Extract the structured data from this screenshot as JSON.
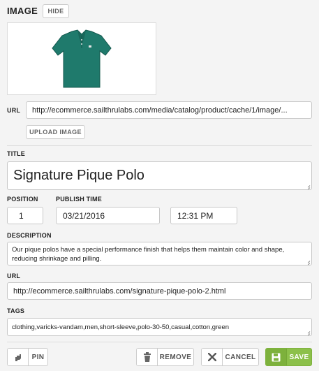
{
  "image_section": {
    "title": "IMAGE",
    "hide_label": "HIDE",
    "url_label": "URL",
    "url_value": "http://ecommerce.sailthrulabs.com/media/catalog/product/cache/1/image/...",
    "upload_label": "UPLOAD IMAGE",
    "thumbnail_color": "#1f7a6c"
  },
  "form": {
    "title_label": "TITLE",
    "title_value": "Signature Pique Polo",
    "position_label": "POSITION",
    "position_value": "1",
    "publish_label": "PUBLISH TIME",
    "publish_date": "03/21/2016",
    "publish_time": "12:31 PM",
    "description_label": "DESCRIPTION",
    "description_value": "Our pique polos have a special performance finish that helps them maintain color and shape, reducing shrinkage and pilling.",
    "url_label": "URL",
    "url_value": "http://ecommerce.sailthrulabs.com/signature-pique-polo-2.html",
    "tags_label": "TAGS",
    "tags_value": "clothing,varicks-vandam,men,short-sleeve,polo-30-50,casual,cotton,green"
  },
  "actions": {
    "pin": "PIN",
    "remove": "REMOVE",
    "cancel": "CANCEL",
    "save": "SAVE",
    "save_color": "#8cc04a"
  }
}
